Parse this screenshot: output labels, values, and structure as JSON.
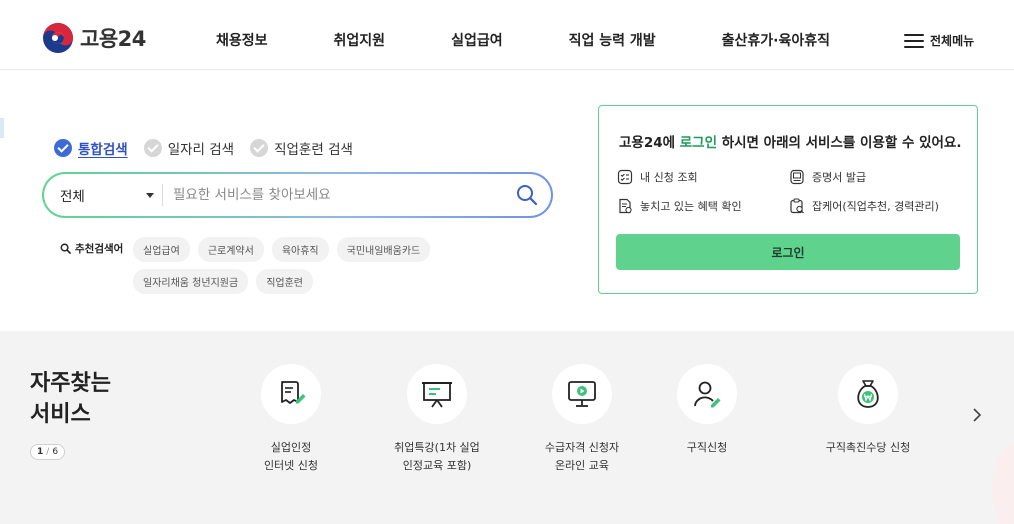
{
  "header": {
    "logo_text": "고용24",
    "nav": [
      "채용정보",
      "취업지원",
      "실업급여",
      "직업 능력 개발",
      "출산휴가·육아휴직"
    ],
    "all_menu_label": "전체메뉴"
  },
  "search": {
    "tabs": [
      {
        "label": "통합검색",
        "active": true
      },
      {
        "label": "일자리 검색",
        "active": false
      },
      {
        "label": "직업훈련 검색",
        "active": false
      }
    ],
    "scope_selected": "전체",
    "placeholder": "필요한 서비스를 찾아보세요",
    "recommended_label": "추천검색어",
    "recommended": [
      "실업급여",
      "근로계약서",
      "육아휴직",
      "국민내일배움카드",
      "일자리채움 청년지원금",
      "직업훈련"
    ]
  },
  "login_box": {
    "title_pre": "고용24에 ",
    "title_highlight": "로그인",
    "title_post": " 하시면 아래의 서비스를 이용할 수 있어요.",
    "items": [
      {
        "icon": "checklist-icon",
        "label": "내 신청 조회"
      },
      {
        "icon": "certificate-icon",
        "label": "증명서 발급"
      },
      {
        "icon": "benefit-doc-icon",
        "label": "놓치고 있는 혜택 확인"
      },
      {
        "icon": "clipboard-search-icon",
        "label": "잡케어(직업추천, 경력관리)"
      }
    ],
    "login_button": "로그인"
  },
  "frequent": {
    "title": "자주찾는\n서비스",
    "page_current": "1",
    "page_sep": "/",
    "page_total": "6",
    "services": [
      {
        "icon": "document-pen-icon",
        "label": "실업인정\n인터넷 신청"
      },
      {
        "icon": "presentation-board-icon",
        "label": "취업특강(1차 실업\n인정교육 포함)"
      },
      {
        "icon": "monitor-play-icon",
        "label": "수급자격 신청자\n온라인 교육"
      },
      {
        "icon": "person-pen-icon",
        "label": "구직신청"
      },
      {
        "icon": "money-bag-icon",
        "label": "구직촉진수당 신청"
      }
    ]
  },
  "colors": {
    "primary_green": "#5fd38d",
    "highlight_green": "#1f9b5b",
    "active_blue": "#3d6ad6",
    "band_gray": "#f3f3f3"
  }
}
